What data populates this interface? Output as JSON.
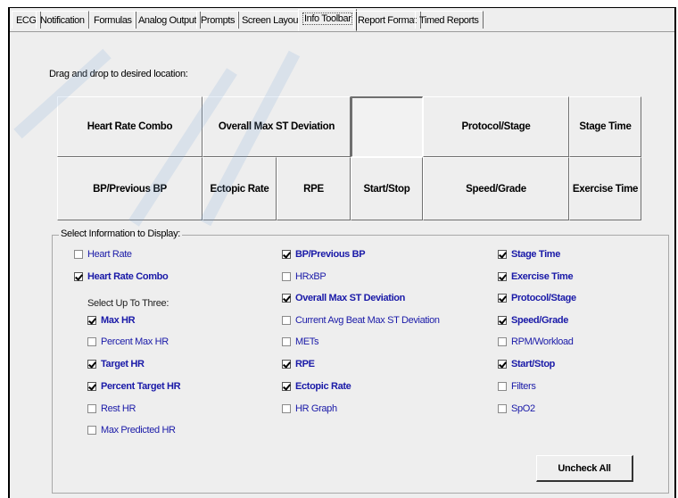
{
  "tabs": [
    {
      "label": "ECG",
      "active": false
    },
    {
      "label": "Notification",
      "active": false
    },
    {
      "label": "Formulas",
      "active": false
    },
    {
      "label": "Analog Output",
      "active": false
    },
    {
      "label": "Prompts",
      "active": false
    },
    {
      "label": "Screen Layout",
      "active": false
    },
    {
      "label": "Info Toolbar",
      "active": true
    },
    {
      "label": "Report Format",
      "active": false
    },
    {
      "label": "Timed Reports",
      "active": false
    }
  ],
  "layout": {
    "drag_label": "Drag and drop to desired location:",
    "row1": [
      "Heart Rate Combo",
      "Overall Max ST Deviation",
      "",
      "Protocol/Stage",
      "Stage Time"
    ],
    "row2": [
      "BP/Previous BP",
      "Ectopic Rate",
      "RPE",
      "Start/Stop",
      "Speed/Grade",
      "Exercise Time"
    ]
  },
  "select": {
    "legend": "Select Information to Display:",
    "select_up_label": "Select Up To Three:",
    "col1": [
      {
        "label": "Heart Rate",
        "checked": false
      },
      {
        "label": "Heart Rate Combo",
        "checked": true
      }
    ],
    "col1_sub": [
      {
        "label": "Max HR",
        "checked": true
      },
      {
        "label": "Percent Max HR",
        "checked": false
      },
      {
        "label": "Target HR",
        "checked": true
      },
      {
        "label": "Percent Target HR",
        "checked": true
      },
      {
        "label": "Rest HR",
        "checked": false
      },
      {
        "label": "Max Predicted HR",
        "checked": false
      }
    ],
    "col2": [
      {
        "label": "BP/Previous BP",
        "checked": true
      },
      {
        "label": "HRxBP",
        "checked": false
      },
      {
        "label": "Overall Max ST Deviation",
        "checked": true
      },
      {
        "label": "Current Avg Beat Max ST Deviation",
        "checked": false
      },
      {
        "label": "METs",
        "checked": false
      },
      {
        "label": "RPE",
        "checked": true
      },
      {
        "label": "Ectopic Rate",
        "checked": true
      },
      {
        "label": "HR Graph",
        "checked": false
      }
    ],
    "col3": [
      {
        "label": "Stage Time",
        "checked": true
      },
      {
        "label": "Exercise Time",
        "checked": true
      },
      {
        "label": "Protocol/Stage",
        "checked": true
      },
      {
        "label": "Speed/Grade",
        "checked": true
      },
      {
        "label": "RPM/Workload",
        "checked": false
      },
      {
        "label": "Start/Stop",
        "checked": true
      },
      {
        "label": "Filters",
        "checked": false
      },
      {
        "label": "SpO2",
        "checked": false
      }
    ]
  },
  "buttons": {
    "uncheck_all": "Uncheck All"
  },
  "colors": {
    "label_blue": "#1a1aa8",
    "panel_gray": "#eeeeee"
  }
}
